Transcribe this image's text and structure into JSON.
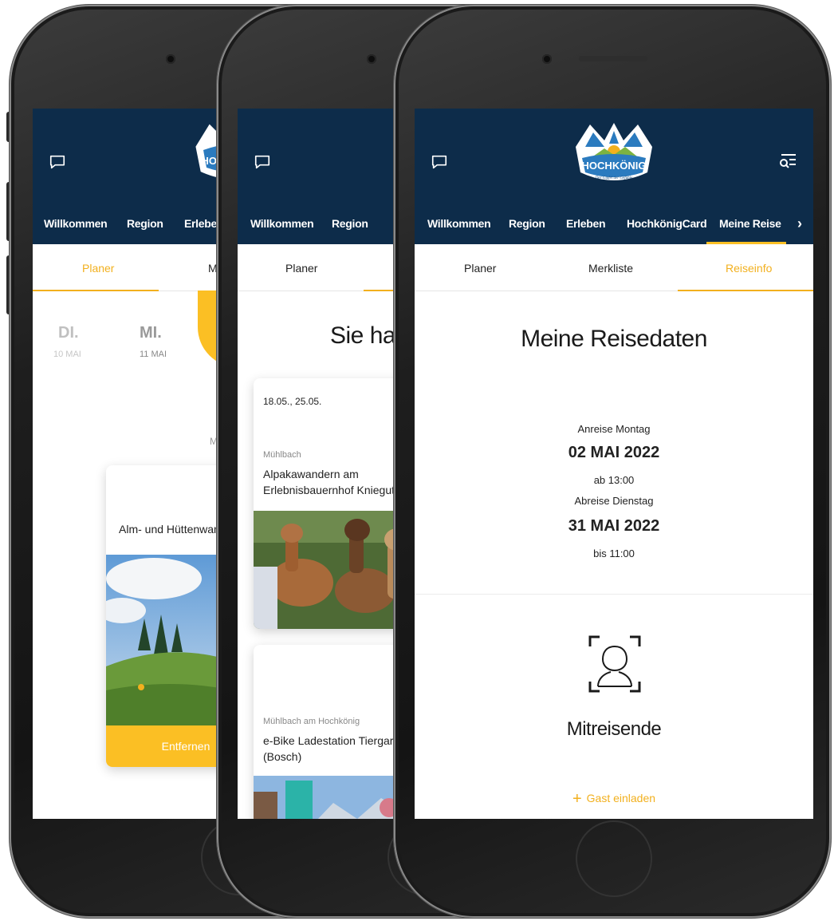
{
  "header": {
    "logo_text": "HOCHKÖNIG",
    "logo_tagline": "Der Gipfel der Gefühle",
    "nav": [
      "Willkommen",
      "Region",
      "Erleben",
      "HochkönigCard",
      "Meine Reise"
    ],
    "nav_active": "Meine Reise",
    "p1_nav_partial": "Erlebe"
  },
  "subtabs": {
    "planer": "Planer",
    "merkliste": "Merkliste",
    "reiseinfo": "Reiseinfo",
    "p1_partial": "M"
  },
  "phone1": {
    "days": [
      {
        "day": "DI.",
        "date": "10 MAI"
      },
      {
        "day": "MI.",
        "date": "11 MAI"
      }
    ],
    "faint_letter": "M",
    "card": {
      "title": "Alm- und Hüttenwand",
      "button": "Entfernen"
    }
  },
  "phone2": {
    "heading_partial": "Sie hab",
    "card1": {
      "dates": "18.05., 25.05.",
      "location": "Mühlbach",
      "title": "Alpakawandern am Erlebnisbauernhof Kniegut"
    },
    "card2": {
      "location": "Mühlbach am Hochkönig",
      "title": "e-Bike Ladestation Tiergarten (Bosch)"
    }
  },
  "phone3": {
    "title": "Meine Reisedaten",
    "arrival_label": "Anreise Montag",
    "arrival_date": "02 MAI 2022",
    "arrival_time": "ab 13:00",
    "departure_label": "Abreise Dienstag",
    "departure_date": "31 MAI 2022",
    "departure_time": "bis 11:00",
    "companions_title": "Mitreisende",
    "add_guest": "Gast einladen"
  },
  "colors": {
    "navy": "#0d2c4a",
    "accent": "#f2b01e",
    "accent_fill": "#fbbf24"
  }
}
